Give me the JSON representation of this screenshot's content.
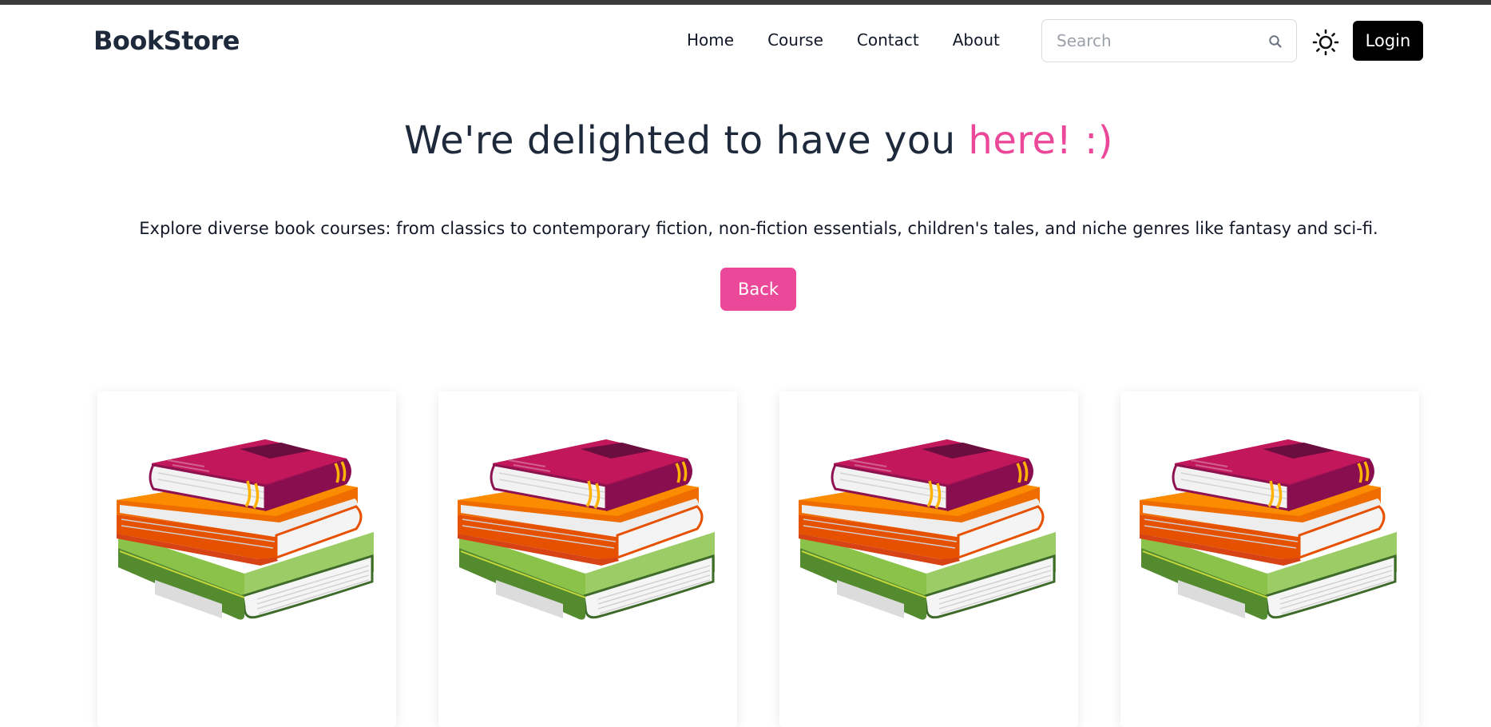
{
  "navbar": {
    "brand": "BookStore",
    "links": [
      "Home",
      "Course",
      "Contact",
      "About"
    ],
    "search_placeholder": "Search",
    "login_label": "Login"
  },
  "hero": {
    "title_main": "We're delighted to have you ",
    "title_accent": "here! :)",
    "description": "Explore diverse book courses: from classics to contemporary fiction, non-fiction essentials, children's tales, and niche genres like fantasy and sci-fi.",
    "back_label": "Back"
  },
  "colors": {
    "accent": "#ec4899",
    "text_dark": "#1e2a3b",
    "login_bg": "#000000"
  },
  "cards": [
    {
      "image": "book-stack-illustration"
    },
    {
      "image": "book-stack-illustration"
    },
    {
      "image": "book-stack-illustration"
    },
    {
      "image": "book-stack-illustration"
    }
  ]
}
